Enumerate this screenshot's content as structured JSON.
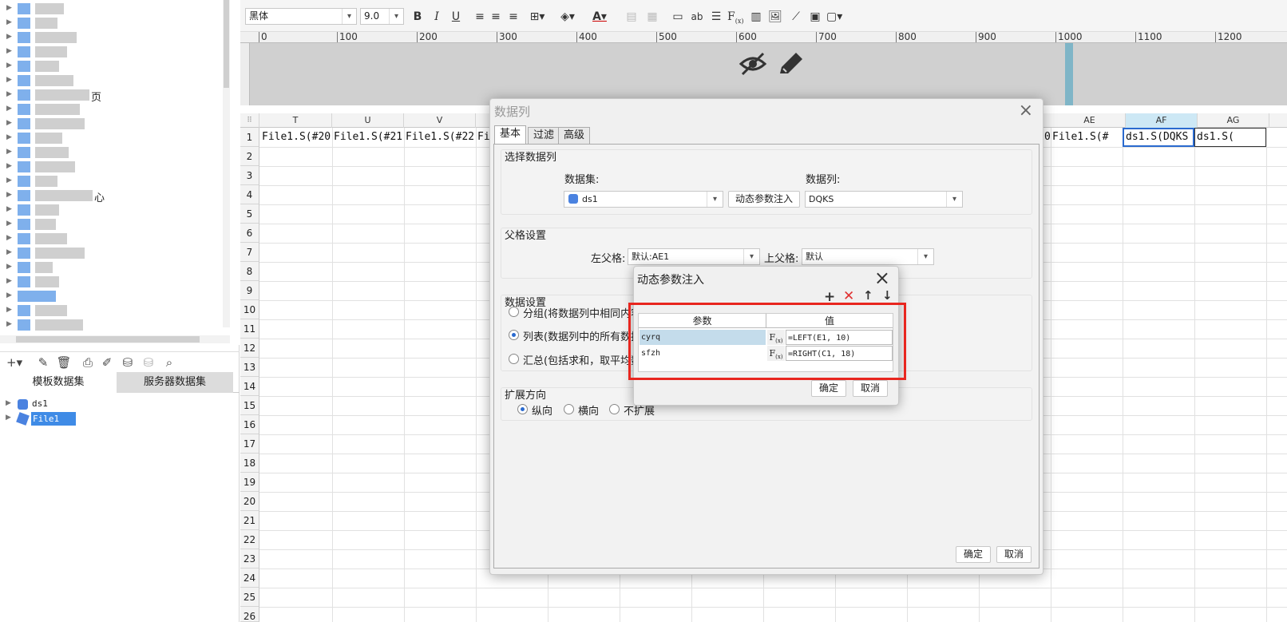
{
  "toolbar": {
    "font_name": "黑体",
    "font_size": "9.0"
  },
  "ruler": {
    "ticks": [
      "0",
      "100",
      "200",
      "300",
      "400",
      "500",
      "600",
      "700",
      "800",
      "900",
      "1000",
      "1100",
      "1200"
    ]
  },
  "left_panel": {
    "tree_visible_labels": [
      "页",
      "心"
    ],
    "tabs": [
      "模板数据集",
      "服务器数据集"
    ],
    "datasets": [
      "ds1",
      "File1"
    ]
  },
  "sheet": {
    "columns": [
      "T",
      "U",
      "V",
      "AE",
      "AF",
      "AG"
    ],
    "rows": [
      "1",
      "2",
      "3",
      "4",
      "5",
      "6",
      "7",
      "8",
      "9",
      "10",
      "11",
      "12",
      "13",
      "14",
      "15",
      "16",
      "17",
      "18",
      "19",
      "20",
      "21",
      "22",
      "23",
      "24",
      "25",
      "26"
    ],
    "row1_cells": {
      "T": "File1.S(#20",
      "U": "File1.S(#21",
      "V": "File1.S(#22",
      "V_overflow": "Fi",
      "AD_tail": "0",
      "AE": "File1.S(#",
      "AF": "ds1.S(DQKS",
      "AG": "ds1.S("
    }
  },
  "dialog": {
    "title": "数据列",
    "tabs": [
      "基本",
      "过滤",
      "高级"
    ],
    "select_column": {
      "title": "选择数据列",
      "dataset_label": "数据集:",
      "dataset_value": "ds1",
      "dynamic_button": "动态参数注入",
      "column_label": "数据列:",
      "column_value": "DQKS"
    },
    "parent": {
      "title": "父格设置",
      "left_label": "左父格:",
      "left_value": "默认:AE1",
      "top_label": "上父格:",
      "top_value": "默认"
    },
    "data_setting": {
      "title": "数据设置",
      "options": [
        "分组(将数据列中相同内容的",
        "列表(数据列中的所有数据",
        "汇总(包括求和，取平均数"
      ],
      "selected_index": 1
    },
    "expand": {
      "title": "扩展方向",
      "options": [
        "纵向",
        "横向",
        "不扩展"
      ],
      "selected_index": 0
    },
    "ok": "确定",
    "cancel": "取消"
  },
  "sub_dialog": {
    "title": "动态参数注入",
    "header_param": "参数",
    "header_value": "值",
    "rows": [
      {
        "param": "cyrq",
        "value": "=LEFT(E1, 10)"
      },
      {
        "param": "sfzh",
        "value": "=RIGHT(C1, 18)"
      }
    ],
    "ok": "确定",
    "cancel": "取消"
  },
  "colors": {
    "highlight_red": "#e8261f",
    "selection_blue": "#2a6acf",
    "header_bg": "#f3f3f3"
  }
}
